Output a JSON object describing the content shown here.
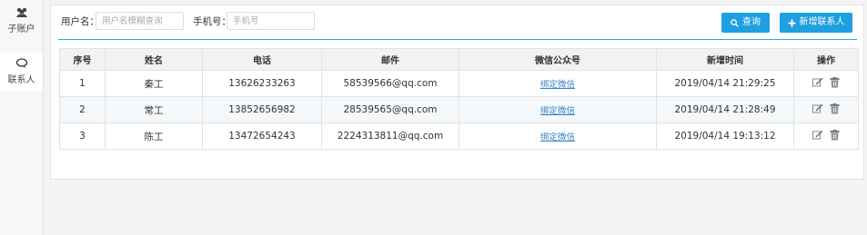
{
  "sidebar": {
    "items": [
      {
        "label": "子账户",
        "icon": "users-icon",
        "active": false
      },
      {
        "label": "联系人",
        "icon": "chat-icon",
        "active": true
      }
    ]
  },
  "search": {
    "username_label": "用户名：",
    "username_placeholder": "用户名模糊查询",
    "username_value": "",
    "phone_label": "手机号：",
    "phone_placeholder": "手机号",
    "phone_value": ""
  },
  "toolbar": {
    "query_label": "查询",
    "add_label": "新增联系人",
    "accent": "#1e9fe0"
  },
  "table": {
    "headers": [
      "序号",
      "姓名",
      "电话",
      "邮件",
      "微信公众号",
      "新增时间",
      "操作"
    ],
    "rows": [
      {
        "no": "1",
        "name": "秦工",
        "phone": "13626233263",
        "email": "58539566@qq.com",
        "wechat": "绑定微信",
        "time": "2019/04/14 21:29:25"
      },
      {
        "no": "2",
        "name": "常工",
        "phone": "13852656982",
        "email": "28539565@qq.com",
        "wechat": "绑定微信",
        "time": "2019/04/14 21:28:49"
      },
      {
        "no": "3",
        "name": "陈工",
        "phone": "13472654243",
        "email": "2224313811@qq.com",
        "wechat": "绑定微信",
        "time": "2019/04/14 19:13:12"
      }
    ],
    "row_actions": [
      "edit-icon",
      "delete-icon"
    ]
  }
}
